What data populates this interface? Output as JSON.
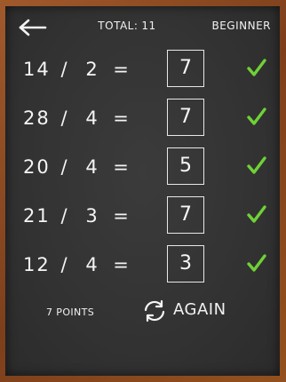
{
  "header": {
    "back_icon": "back-arrow-icon",
    "total_label": "TOTAL:",
    "total_value": "11",
    "level": "BEGINNER"
  },
  "problems": [
    {
      "a": "14",
      "op": "/",
      "b": "2",
      "eq": "=",
      "answer": "7",
      "status": "correct"
    },
    {
      "a": "28",
      "op": "/",
      "b": "4",
      "eq": "=",
      "answer": "7",
      "status": "correct"
    },
    {
      "a": "20",
      "op": "/",
      "b": "4",
      "eq": "=",
      "answer": "5",
      "status": "correct"
    },
    {
      "a": "21",
      "op": "/",
      "b": "3",
      "eq": "=",
      "answer": "7",
      "status": "correct"
    },
    {
      "a": "12",
      "op": "/",
      "b": "4",
      "eq": "=",
      "answer": "3",
      "status": "correct"
    }
  ],
  "footer": {
    "points": "7 POINTS",
    "again_label": "AGAIN",
    "again_icon": "refresh-icon"
  },
  "colors": {
    "board": "#333333",
    "frame": "#8a4a22",
    "chalk": "#f2f2f2",
    "check": "#6fd136"
  }
}
